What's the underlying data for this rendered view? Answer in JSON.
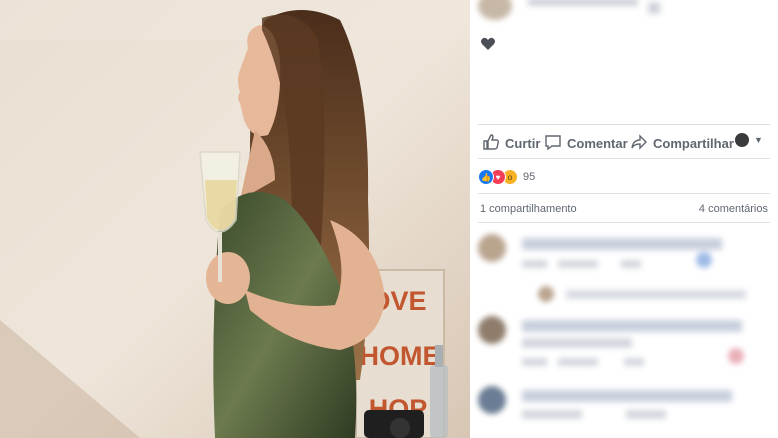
{
  "post": {
    "actions": {
      "like_label": "Curtir",
      "comment_label": "Comentar",
      "share_label": "Compartilhar"
    },
    "reactions": {
      "count": "95",
      "icons": [
        "like-icon",
        "love-icon",
        "wow-icon"
      ]
    },
    "shares_text": "1 compartilhamento",
    "comments_text": "4 comentários"
  },
  "photo": {
    "sign_lines": [
      "OVE",
      "HOME",
      "HOP"
    ]
  },
  "colors": {
    "like_blue": "#1877f2",
    "love_red": "#f33e58",
    "wow_yellow": "#f7b125",
    "action_gray": "#606770",
    "divider": "#dddfe2"
  }
}
